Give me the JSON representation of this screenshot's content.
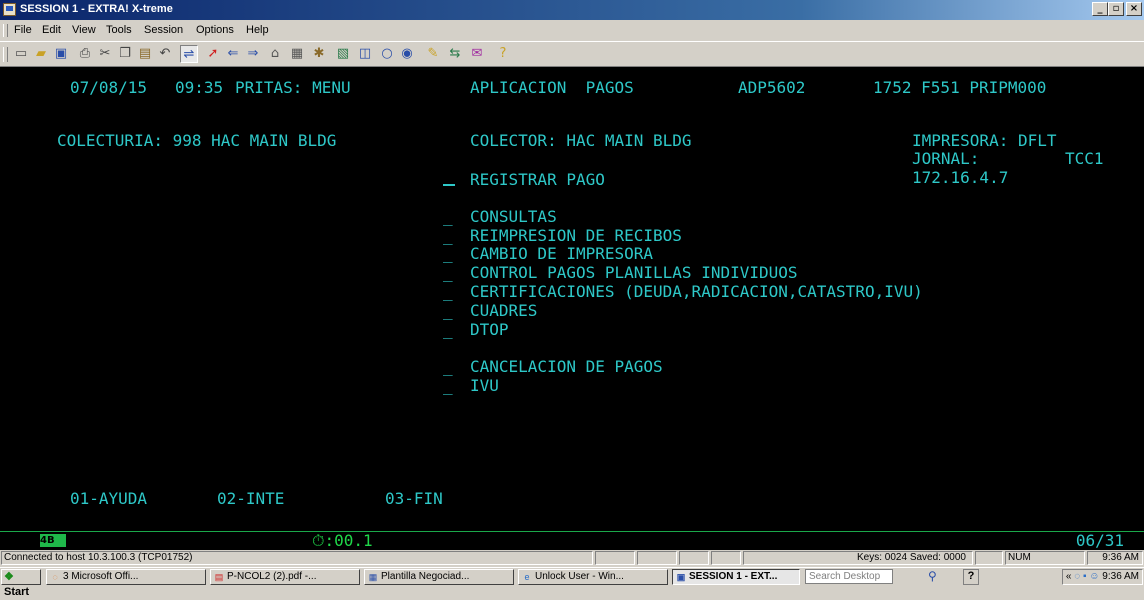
{
  "window": {
    "title": "SESSION 1 - EXTRA! X-treme",
    "controls": {
      "minimize": "_",
      "maximize": "▫",
      "close": "×"
    }
  },
  "menu": [
    "File",
    "Edit",
    "View",
    "Tools",
    "Session",
    "Options",
    "Help"
  ],
  "toolbar_icons": [
    "new-icon",
    "open-icon",
    "save-icon",
    "print-icon",
    "cut-icon",
    "copy-icon",
    "paste-icon",
    "undo-icon",
    "connect-icon",
    "macro-icon",
    "back-icon",
    "forward-icon",
    "home-icon",
    "stop-icon",
    "tools-icon",
    "capture-icon",
    "zoom-icon",
    "circle-icon",
    "browser-icon",
    "edit-icon",
    "transfer-icon",
    "send-icon",
    "help-icon"
  ],
  "screen": {
    "header": {
      "date": "07/08/15",
      "time": "09:35",
      "program": "PRITAS: MENU",
      "title": "APLICACION  PAGOS",
      "code": "ADP5602",
      "ids": "1752 F551 PRIPM000"
    },
    "colecturia": "COLECTURIA: 998 HAC MAIN BLDG",
    "colector": "COLECTOR: HAC MAIN BLDG",
    "impresora": "IMPRESORA: DFLT",
    "jornal_label": "JORNAL:",
    "jornal_value": "TCC1",
    "ip": "172.16.4.7",
    "options": [
      "REGISTRAR PAGO",
      "CONSULTAS",
      "REIMPRESION DE RECIBOS",
      "CAMBIO DE IMPRESORA",
      "CONTROL PAGOS PLANILLAS INDIVIDUOS",
      "CERTIFICACIONES (DEUDA,RADICACION,CATASTRO,IVU)",
      "CUADRES",
      "DTOP",
      "CANCELACION DE PAGOS",
      "IVU"
    ],
    "function_keys": [
      "01-AYUDA",
      "02-INTE",
      "03-FIN"
    ]
  },
  "oia": {
    "indicator": "4B",
    "timer": "⏱:00.1",
    "cursor_position": "06/31"
  },
  "status": {
    "connection": "Connected to host 10.3.100.3 (TCP01752)",
    "keys": "Keys: 0024  Saved: 0000",
    "num": "NUM",
    "time": "9:36 AM"
  },
  "taskbar": {
    "start": "Start",
    "tasks": [
      "3 Microsoft Offi...",
      "P-NCOL2 (2).pdf -...",
      "Plantilla Negociad...",
      "Unlock User - Win...",
      "SESSION 1 - EXT..."
    ],
    "search_placeholder": "Search Desktop",
    "clock": "9:36 AM"
  }
}
